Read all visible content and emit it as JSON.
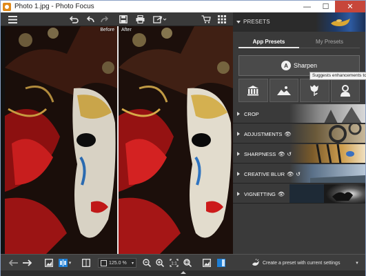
{
  "window": {
    "title": "Photo 1.jpg - Photo Focus"
  },
  "window_controls": {
    "minimize": "—",
    "maximize": "☐",
    "close": "✕"
  },
  "toolbar": {
    "menu_icon": "menu-icon",
    "undo_icon": "undo-icon",
    "undo_all_icon": "undo-all-icon",
    "redo_icon": "redo-icon",
    "save_icon": "save-icon",
    "print_icon": "print-icon",
    "share_icon": "share-icon",
    "cart_icon": "cart-icon",
    "grid_icon": "grid-icon"
  },
  "photo": {
    "before_label": "Before",
    "after_label": "After"
  },
  "panel": {
    "header": "PRESETS",
    "tabs": [
      {
        "label": "App Presets",
        "active": true
      },
      {
        "label": "My Presets",
        "active": false
      }
    ],
    "sharpen_button": {
      "icon_letter": "A",
      "label": "Sharpen"
    },
    "tooltip": "Suggests enhancements to",
    "categories": [
      "landmark-icon",
      "landscape-icon",
      "flower-icon",
      "portrait-icon"
    ],
    "sections": [
      {
        "label": "CROP"
      },
      {
        "label": "ADJUSTMENTS"
      },
      {
        "label": "SHARPNESS"
      },
      {
        "label": "CREATIVE BLUR"
      },
      {
        "label": "VIGNETTING"
      }
    ]
  },
  "bottombar": {
    "zoom": "125.0 %",
    "create_preset": "Create a preset with current settings"
  },
  "colors": {
    "accent": "#1e7fd6",
    "panel": "#3a3a3a",
    "toolbar": "#3a3a3a",
    "close": "#c7463a"
  }
}
